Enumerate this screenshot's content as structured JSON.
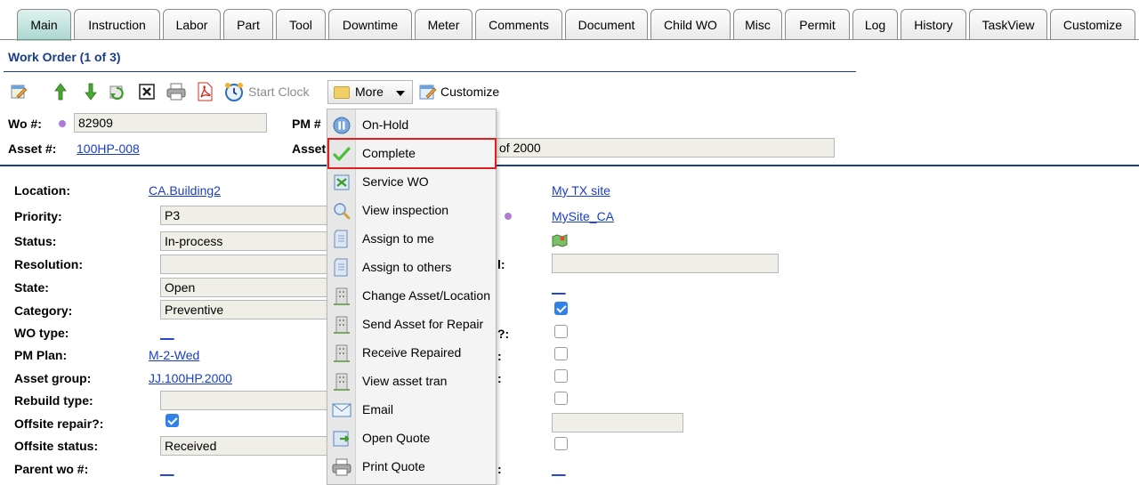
{
  "tabs": [
    {
      "label": "Main",
      "active": true
    },
    {
      "label": "Instruction"
    },
    {
      "label": "Labor"
    },
    {
      "label": "Part"
    },
    {
      "label": "Tool"
    },
    {
      "label": "Downtime"
    },
    {
      "label": "Meter"
    },
    {
      "label": "Comments"
    },
    {
      "label": "Document"
    },
    {
      "label": "Child WO"
    },
    {
      "label": "Misc"
    },
    {
      "label": "Permit"
    },
    {
      "label": "Log"
    },
    {
      "label": "History"
    },
    {
      "label": "TaskView"
    },
    {
      "label": "Customize"
    }
  ],
  "section_title": "Work Order (1 of 3)",
  "toolbar": {
    "start_clock_label": "Start Clock",
    "more_label": "More",
    "customize_label": "Customize"
  },
  "header": {
    "wo_label": "Wo #:",
    "wo_value": "82909",
    "pm_label": "PM #",
    "asset_label": "Asset #:",
    "asset_value": "100HP-008",
    "asset_desc_label": "Asset",
    "asset_desc_value": "of 2000"
  },
  "left_fields": {
    "location": {
      "label": "Location:",
      "value": "CA.Building2"
    },
    "priority": {
      "label": "Priority:",
      "value": "P3"
    },
    "status": {
      "label": "Status:",
      "value": "In-process"
    },
    "resolution": {
      "label": "Resolution:",
      "value": ""
    },
    "state": {
      "label": "State:",
      "value": "Open"
    },
    "category": {
      "label": "Category:",
      "value": "Preventive"
    },
    "wo_type": {
      "label": "WO type:",
      "value": "__"
    },
    "pm_plan": {
      "label": "PM Plan:",
      "value": "M-2-Wed"
    },
    "asset_group": {
      "label": "Asset group:",
      "value": "JJ.100HP.2000"
    },
    "rebuild_type": {
      "label": "Rebuild type:",
      "value": ""
    },
    "offsite_repair": {
      "label": "Offsite repair?:",
      "checked": true
    },
    "offsite_status": {
      "label": "Offsite status:",
      "value": "Received"
    },
    "parent_wo": {
      "label": "Parent wo #:",
      "value": "__"
    }
  },
  "right_fields": {
    "site_link": "My TX site",
    "mysite_link": "MySite_CA",
    "label_frag_1": "l:",
    "label_frag_2": "?:",
    "label_frag_3": ":",
    "label_frag_4": ":",
    "label_frag_5": ":",
    "underscore_link_1": "__",
    "underscore_link_2": "__",
    "checkboxes": [
      true,
      false,
      false,
      false,
      false,
      false
    ]
  },
  "menu": {
    "items": [
      {
        "label": "On-Hold",
        "icon": "pause-icon"
      },
      {
        "label": "Complete",
        "icon": "checkmark-icon"
      },
      {
        "label": "Service WO",
        "icon": "service-wo-icon"
      },
      {
        "label": "View inspection",
        "icon": "magnifier-icon"
      },
      {
        "label": "Assign to me",
        "icon": "document-icon"
      },
      {
        "label": "Assign to others",
        "icon": "document-icon"
      },
      {
        "label": "Change Asset/Location",
        "icon": "building-icon"
      },
      {
        "label": "Send Asset for Repair",
        "icon": "building-icon"
      },
      {
        "label": "Receive Repaired",
        "icon": "building-icon"
      },
      {
        "label": "View asset tran",
        "icon": "building-icon"
      },
      {
        "label": "Email",
        "icon": "envelope-icon"
      },
      {
        "label": "Open Quote",
        "icon": "open-quote-icon"
      },
      {
        "label": "Print Quote",
        "icon": "printer-icon"
      }
    ]
  },
  "colors": {
    "accent_blue": "#1a3d8c",
    "link_blue": "#1a3dc8",
    "highlight_red": "#e02020",
    "active_tab": "#a9d6d0",
    "field_bg": "#efeee7"
  }
}
